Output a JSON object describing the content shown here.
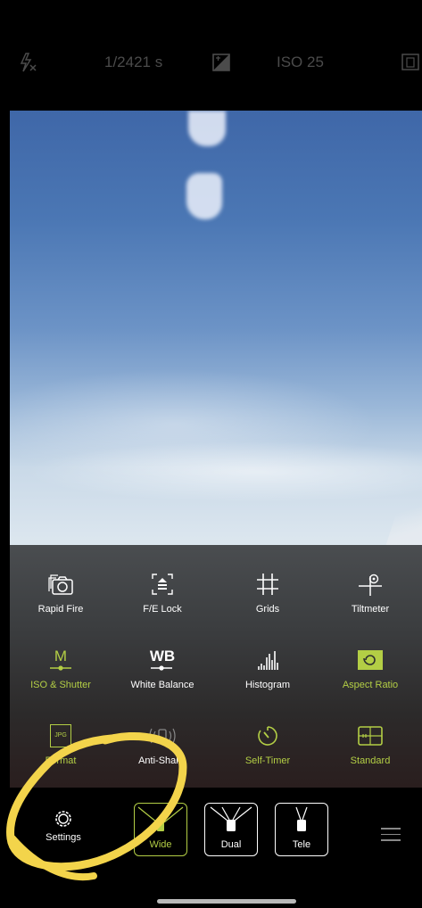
{
  "top_bar": {
    "flash_icon": "flash-off-icon",
    "shutter_speed": "1/2421 s",
    "exposure_icon": "exposure-compensation-icon",
    "iso": "ISO 25",
    "menu_icon": "camera-menu-icon"
  },
  "panel": {
    "rows": [
      [
        {
          "label": "Rapid Fire",
          "icon": "rapid-fire-icon"
        },
        {
          "label": "F/E Lock",
          "icon": "fe-lock-icon"
        },
        {
          "label": "Grids",
          "icon": "grid-icon"
        },
        {
          "label": "Tiltmeter",
          "icon": "tiltmeter-icon"
        }
      ],
      [
        {
          "label": "ISO & Shutter",
          "icon": "manual-icon",
          "icon_text": "M"
        },
        {
          "label": "White Balance",
          "icon": "white-balance-icon",
          "icon_text": "WB"
        },
        {
          "label": "Histogram",
          "icon": "histogram-icon"
        },
        {
          "label": "Aspect Ratio",
          "icon": "aspect-ratio-icon"
        }
      ],
      [
        {
          "label": "Format",
          "icon": "jpg-format-icon",
          "icon_text": "JPG"
        },
        {
          "label": "Anti-Shake",
          "icon": "anti-shake-icon"
        },
        {
          "label": "Self-Timer",
          "icon": "self-timer-icon"
        },
        {
          "label": "Standard",
          "icon": "standard-mode-icon"
        }
      ]
    ]
  },
  "bottom_bar": {
    "settings_label": "Settings",
    "lenses": {
      "wide": "Wide",
      "dual": "Dual",
      "tele": "Tele"
    },
    "menu_icon": "hamburger-icon"
  },
  "colors": {
    "accent": "#b3ce45",
    "annotation": "#f3d44b"
  }
}
